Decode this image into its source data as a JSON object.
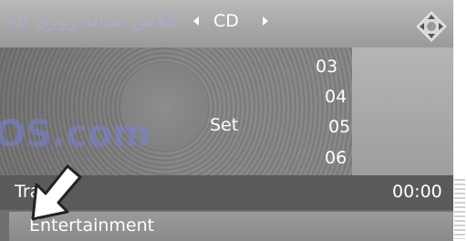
{
  "header": {
    "source": "CD"
  },
  "tracks": {
    "t03": "03",
    "t04": "04",
    "t05": "05",
    "t06": "06"
  },
  "disc": {
    "set_label": "Set"
  },
  "info": {
    "title": "Tra",
    "time": "00:00"
  },
  "menu": {
    "entertainment": "Entertainment"
  },
  "watermark": {
    "persian": "کلاس شبانه روزی ۸۵",
    "latin": "OS.com"
  },
  "colors": {
    "screen_bg": "#6f6f6f",
    "text": "#ffffff",
    "watermark": "#8a90d8"
  },
  "icons": {
    "controller": "controller-joystick-icon",
    "prev": "triangle-left-icon",
    "next": "triangle-right-icon",
    "pointer": "pointer-arrow-icon"
  }
}
